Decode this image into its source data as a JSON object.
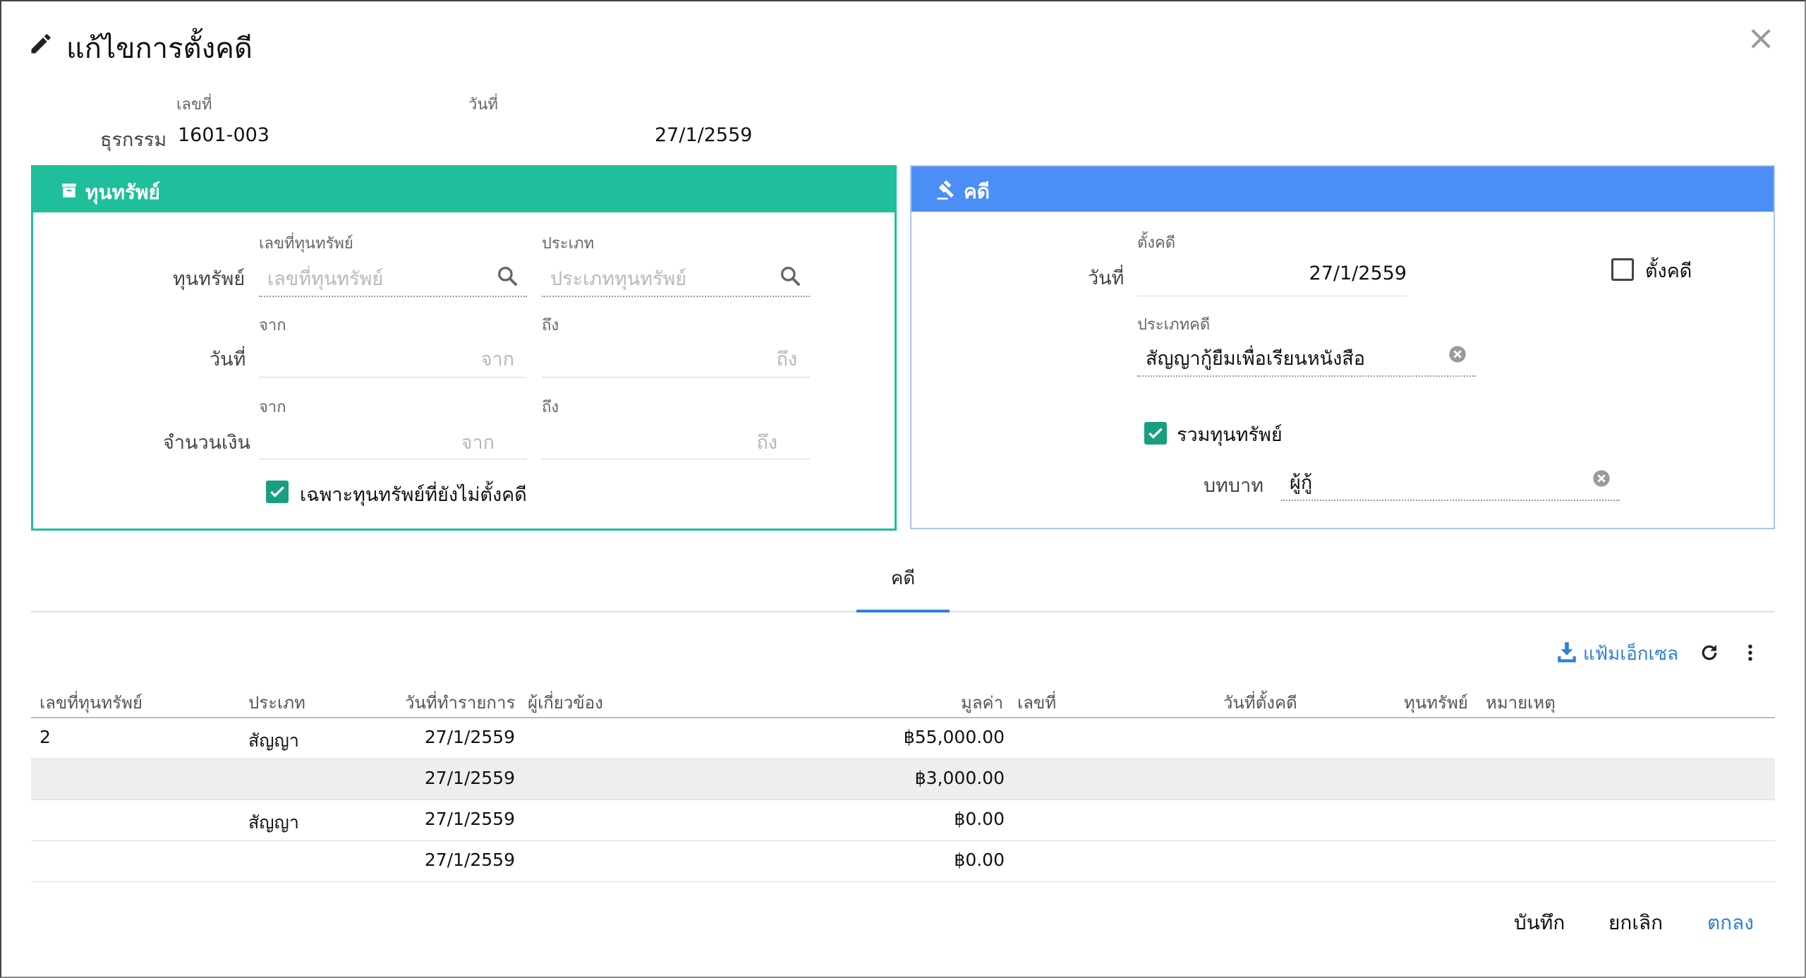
{
  "dialog": {
    "title": "แก้ไขการตั้งคดี",
    "close": "×"
  },
  "header": {
    "doc_no_label": "เลขที่",
    "date_label": "วันที่",
    "txn_label": "ธุรกรรม",
    "doc_no": "1601-003",
    "date": "27/1/2559"
  },
  "asset_panel": {
    "title": "ทุนทรัพย์",
    "asset_row_label": "ทุนทรัพย์",
    "asset_no_label": "เลขที่ทุนทรัพย์",
    "asset_no_placeholder": "เลขที่ทุนทรัพย์",
    "asset_type_label": "ประเภท",
    "asset_type_placeholder": "ประเภททุนทรัพย์",
    "date_row_label": "วันที่",
    "from_label": "จาก",
    "to_label": "ถึง",
    "from_placeholder": "จาก",
    "to_placeholder": "ถึง",
    "amount_row_label": "จำนวนเงิน",
    "only_unfiled_label": "เฉพาะทุนทรัพย์ที่ยังไม่ตั้งคดี",
    "only_unfiled_checked": true
  },
  "case_panel": {
    "title": "คดี",
    "date_row_label": "วันที่",
    "filed_label": "ตั้งคดี",
    "filed_date": "27/1/2559",
    "filed_checkbox_label": "ตั้งคดี",
    "filed_checked": false,
    "case_type_label": "ประเภทคดี",
    "case_type_value": "สัญญากู้ยืมเพื่อเรียนหนังสือ",
    "include_assets_label": "รวมทุนทรัพย์",
    "include_assets_checked": true,
    "role_label": "บทบาท",
    "role_value": "ผู้กู้"
  },
  "tabs": [
    {
      "label": "คดี",
      "active": true
    }
  ],
  "toolbar": {
    "excel_label": "แฟ้มเอ็กเซล"
  },
  "table": {
    "columns": [
      "เลขที่ทุนทรัพย์",
      "ประเภท",
      "วันที่ทำรายการ",
      "ผู้เกี่ยวข้อง",
      "มูลค่า",
      "เลขที่",
      "วันที่ตั้งคดี",
      "ทุนทรัพย์",
      "หมายเหตุ"
    ],
    "rows": [
      {
        "asset_no": "2",
        "type": "สัญญา",
        "date": "27/1/2559",
        "value": "฿55,000.00",
        "highlight": false
      },
      {
        "asset_no": "",
        "type": "",
        "date": "27/1/2559",
        "value": "฿3,000.00",
        "highlight": true
      },
      {
        "asset_no": "",
        "type": "สัญญา",
        "date": "27/1/2559",
        "value": "฿0.00",
        "highlight": false
      },
      {
        "asset_no": "",
        "type": "",
        "date": "27/1/2559",
        "value": "฿0.00",
        "highlight": false
      }
    ]
  },
  "footer": {
    "save_label": "บันทึก",
    "cancel_label": "ยกเลิก",
    "ok_label": "ตกลง"
  },
  "colors": {
    "green": "#1ebf9a",
    "blue": "#4b8ef5",
    "link": "#2f7fd9"
  }
}
